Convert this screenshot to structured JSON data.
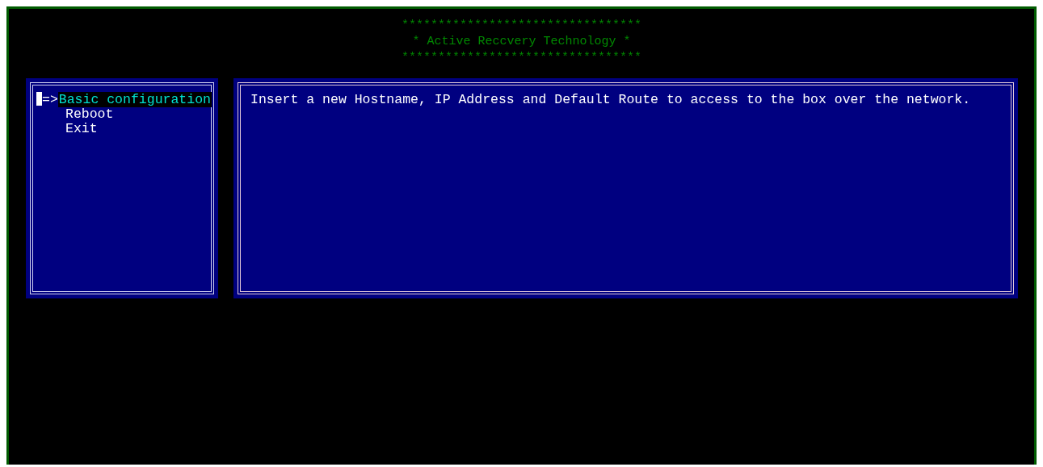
{
  "banner": {
    "lines": [
      "*********************************",
      "* Active Reccvery Technology *",
      "*********************************"
    ]
  },
  "menu": {
    "pointer": "=>",
    "items": [
      {
        "label": "Basic configuration",
        "selected": true
      },
      {
        "label": "Reboot",
        "selected": false
      },
      {
        "label": "Exit",
        "selected": false
      }
    ]
  },
  "description": {
    "text": "Insert a new Hostname, IP Address and Default Route to access to the box over the network."
  }
}
